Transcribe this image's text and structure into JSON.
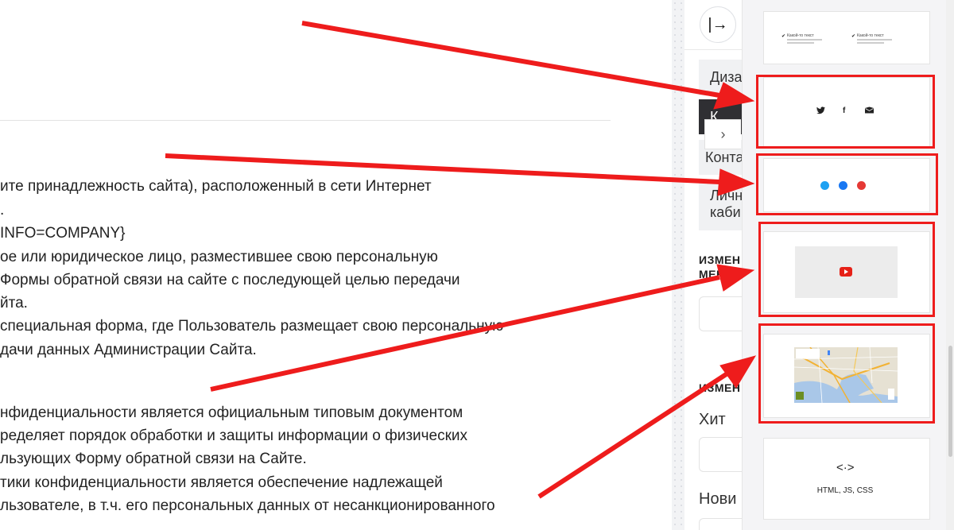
{
  "document": {
    "lines": [
      "ите принадлежность сайта), расположенный в сети Интернет",
      ".",
      "INFO=COMPANY}",
      "ое или юридическое лицо, разместившее свою персональную",
      " Формы обратной связи на сайте с последующей целью передачи",
      "йта.",
      "специальная форма, где Пользователь размещает свою персональную",
      "дачи данных Администрации Сайта.",
      "нфиденциальности является официальным типовым документом",
      "ределяет порядок обработки и защиты информации о физических",
      "льзующих Форму обратной связи на Сайте.",
      "тики конфиденциальности является обеспечение надлежащей",
      "льзователе, в т.ч. его персональных данных от несанкционированного"
    ]
  },
  "panel": {
    "collapse_glyph": "|→",
    "menu": {
      "design": "Диза",
      "active": "К",
      "contacts": "Конта",
      "cabinet_line1": "Личн",
      "cabinet_line2": "каби"
    },
    "expand_glyph": "›",
    "section1_line1": "ИЗМЕН",
    "section1_line2": "МЕНЮ",
    "section2": "ИЗМЕН",
    "field_hit": "Хит",
    "field_new": "Нови"
  },
  "picker": {
    "text_card": {
      "left_heading": "Какой-то текст",
      "right_heading": "Какой-то текст"
    },
    "code_card": {
      "icon": "<·>",
      "label": "HTML, JS, CSS"
    }
  },
  "colors": {
    "highlight": "#ee1c1c",
    "twitter": "#1da1f2",
    "facebook": "#1877f2",
    "mail": "#e53935",
    "youtube": "#e62117"
  }
}
